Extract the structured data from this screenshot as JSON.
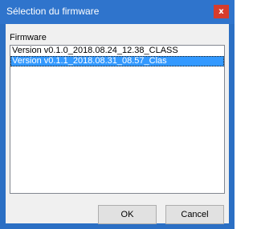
{
  "window": {
    "title": "Sélection du firmware",
    "close_glyph": "x"
  },
  "group": {
    "label": "Firmware"
  },
  "list": {
    "items": [
      {
        "label": "Version v0.1.0_2018.08.24_12.38_CLASS",
        "selected": false
      },
      {
        "label": "Version v0.1.1_2018.08.31_08.57_Clas",
        "selected": true
      }
    ]
  },
  "buttons": {
    "ok_label": "OK",
    "cancel_label": "Cancel"
  },
  "colors": {
    "titlebar": "#2f74cc",
    "close": "#d63c2c",
    "selection": "#3399ff"
  }
}
